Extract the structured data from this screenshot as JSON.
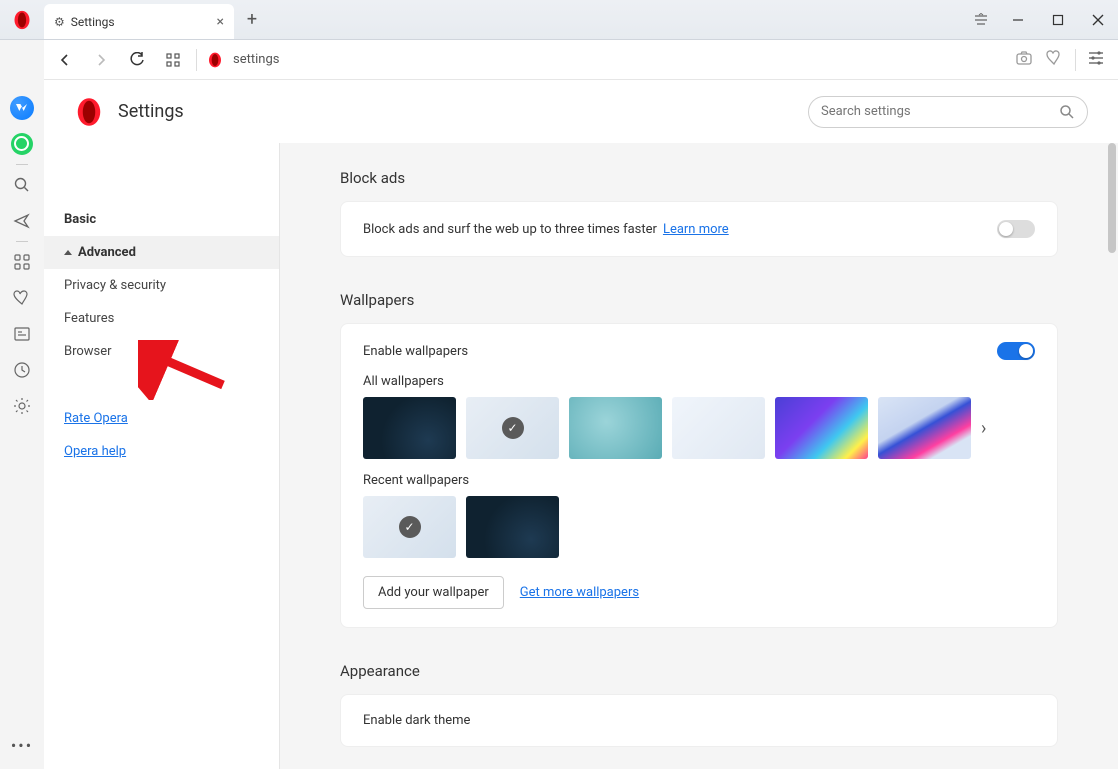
{
  "tab": {
    "label": "Settings"
  },
  "address": {
    "text": "settings"
  },
  "page": {
    "title": "Settings",
    "search_placeholder": "Search settings"
  },
  "nav": {
    "basic": "Basic",
    "advanced": "Advanced",
    "privacy": "Privacy & security",
    "features": "Features",
    "browser": "Browser",
    "rate": "Rate Opera",
    "help": "Opera help"
  },
  "blockads": {
    "heading": "Block ads",
    "text": "Block ads and surf the web up to three times faster",
    "learn": "Learn more"
  },
  "wallpapers": {
    "heading": "Wallpapers",
    "enable": "Enable wallpapers",
    "all": "All wallpapers",
    "recent": "Recent wallpapers",
    "add_btn": "Add your wallpaper",
    "get_more": "Get more wallpapers"
  },
  "appearance": {
    "heading": "Appearance",
    "dark": "Enable dark theme"
  }
}
